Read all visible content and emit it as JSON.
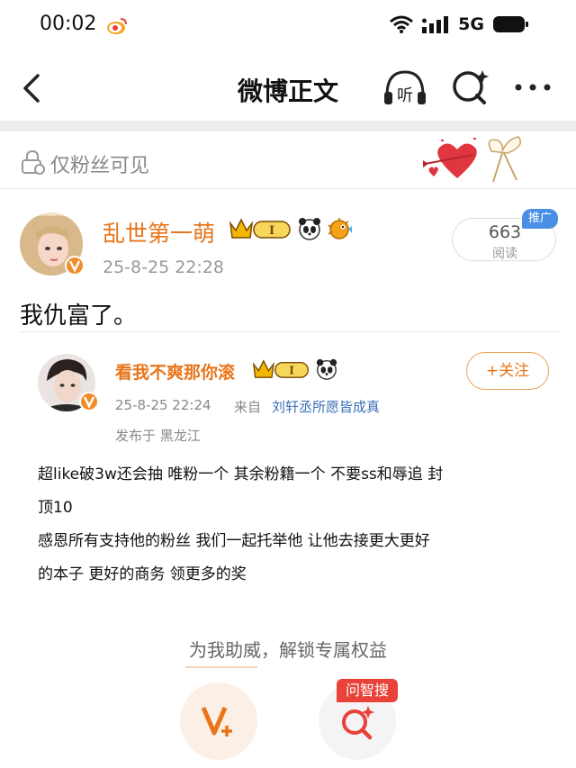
{
  "status_bar": {
    "time": "00:02",
    "network": "5G"
  },
  "nav": {
    "title": "微博正文",
    "listen_label": "听"
  },
  "visibility": {
    "label": "仅粉丝可见"
  },
  "author": {
    "name": "乱世第一萌",
    "time": "25-8-25 22:28",
    "level_label": "I"
  },
  "read": {
    "count": "663",
    "label": "阅读",
    "promo": "推广"
  },
  "post": {
    "text": "我仇富了。"
  },
  "repost": {
    "name": "看我不爽那你滚",
    "level_label": "I",
    "follow_label": "+关注",
    "time": "25-8-25 22:24",
    "source_prefix": "来自",
    "source": "刘轩丞所愿皆成真",
    "location": "发布于 黑龙江",
    "body_lines": [
      "超like破3w还会抽 唯粉一个 其余粉籍一个 不要ss和辱追 封",
      "顶10",
      "感恩所有支持他的粉丝 我们一起托举他 让他去接更大更好",
      "的本子 更好的商务 领更多的奖"
    ]
  },
  "support": {
    "text": "为我助威，解锁专属权益",
    "search_tag": "问智搜"
  },
  "colors": {
    "accent": "#e8751a",
    "link": "#3b6fb6",
    "promo": "#4a8fe4",
    "tag_red": "#e8423a"
  }
}
